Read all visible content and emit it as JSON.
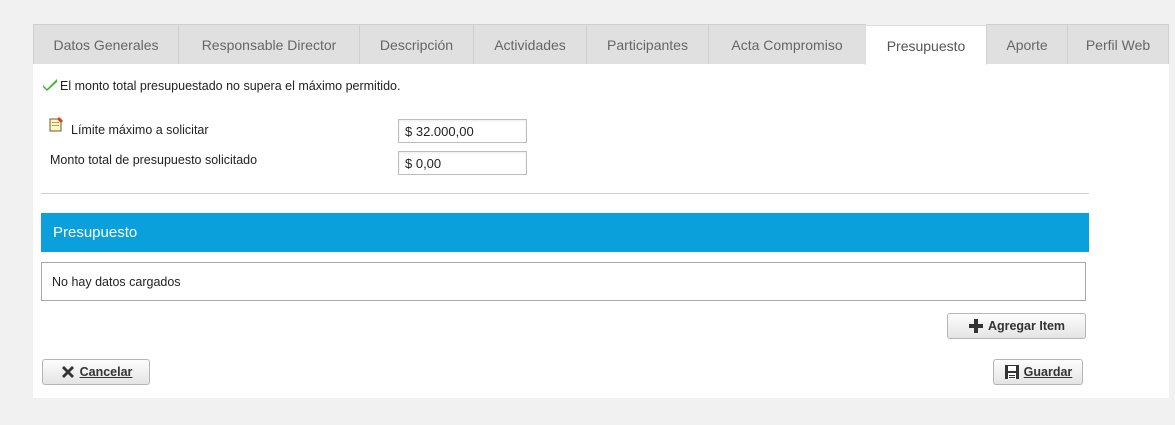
{
  "tabs": [
    {
      "label": "Datos Generales",
      "active": false
    },
    {
      "label": "Responsable Director",
      "active": false
    },
    {
      "label": "Descripción",
      "active": false
    },
    {
      "label": "Actividades",
      "active": false
    },
    {
      "label": "Participantes",
      "active": false
    },
    {
      "label": "Acta Compromiso",
      "active": false
    },
    {
      "label": "Presupuesto",
      "active": true
    },
    {
      "label": "Aporte",
      "active": false
    },
    {
      "label": "Perfil Web",
      "active": false
    }
  ],
  "status": {
    "message": "El monto total presupuestado no supera el máximo permitido.",
    "icon": "check-icon",
    "color": "#3cb531"
  },
  "form": {
    "limit_label": "Límite máximo a solicitar",
    "limit_value": "$ 32.000,00",
    "total_label": "Monto total de presupuesto solicitado",
    "total_value": "$ 0,00"
  },
  "section": {
    "title": "Presupuesto",
    "color": "#0aa0dc",
    "empty_message": "No hay datos cargados"
  },
  "buttons": {
    "add_item_label": "Agregar Item",
    "cancel_label": "Cancelar",
    "save_label": "Guardar"
  }
}
